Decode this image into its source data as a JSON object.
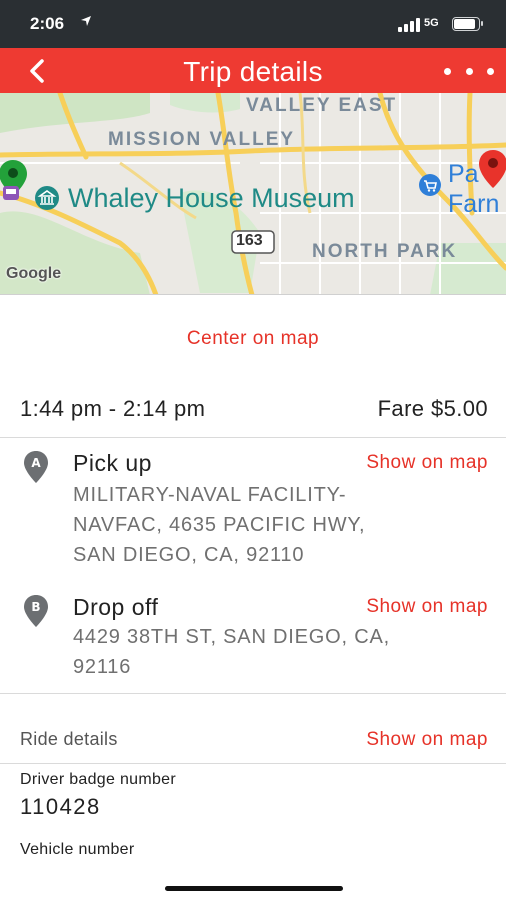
{
  "status_bar": {
    "time": "2:06",
    "network": "5G",
    "icons": [
      "location-arrow-icon",
      "signal-icon",
      "battery-icon"
    ]
  },
  "app_bar": {
    "title": "Trip details",
    "back_icon": "chevron-left-icon",
    "more_icon": "more-dots-icon",
    "color": "#ee3a32"
  },
  "map": {
    "labels": {
      "valley_east": "VALLEY EAST",
      "mission_valley": "MISSION VALLEY",
      "north_park": "NORTH PARK",
      "highway": "163"
    },
    "poi_museum": "Whaley House Museum",
    "poi_farm_line1": "Pa",
    "poi_farm_line2": "Farn",
    "attribution": "Google",
    "pins": [
      "pickup-pin-green",
      "dropoff-pin-red"
    ]
  },
  "center_on_map": "Center on map",
  "trip": {
    "time_range": "1:44 pm - 2:14 pm",
    "fare": "Fare $5.00"
  },
  "pickup": {
    "marker": "A",
    "title": "Pick up",
    "show_on_map": "Show on map",
    "address_lines": [
      "MILITARY-NAVAL FACILITY-",
      "NAVFAC, 4635 PACIFIC HWY,",
      "SAN DIEGO, CA, 92110"
    ]
  },
  "dropoff": {
    "marker": "B",
    "title": "Drop off",
    "show_on_map": "Show on map",
    "address_lines": [
      "4429 38TH ST, SAN DIEGO, CA,",
      "92116"
    ]
  },
  "ride_details": {
    "label": "Ride details",
    "show_on_map": "Show on map",
    "driver_badge_label": "Driver badge number",
    "driver_badge_value": "110428",
    "vehicle_number_label": "Vehicle number"
  },
  "colors": {
    "accent": "#e63228",
    "status_bar": "#2a2f33"
  }
}
